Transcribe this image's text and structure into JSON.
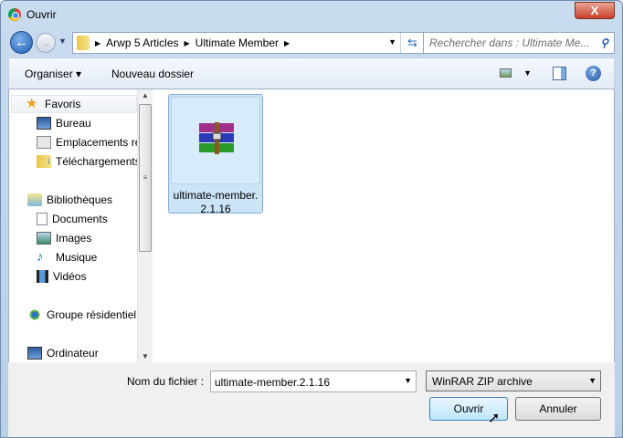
{
  "window": {
    "title": "Ouvrir",
    "close": "X"
  },
  "nav": {
    "breadcrumbs": [
      "Arwp 5 Articles",
      "Ultimate Member"
    ],
    "search_placeholder": "Rechercher dans : Ultimate Me..."
  },
  "toolbar": {
    "organize": "Organiser ▾",
    "new_folder": "Nouveau dossier",
    "help": "?"
  },
  "sidebar": {
    "items": [
      {
        "label": "Favoris",
        "icon": "star-icon"
      },
      {
        "label": "Bureau",
        "icon": "desktop-icon"
      },
      {
        "label": "Emplacements ré",
        "icon": "recent-places-icon"
      },
      {
        "label": "Téléchargements",
        "icon": "downloads-icon"
      },
      {
        "label": "Bibliothèques",
        "icon": "libraries-icon"
      },
      {
        "label": "Documents",
        "icon": "documents-icon"
      },
      {
        "label": "Images",
        "icon": "images-icon"
      },
      {
        "label": "Musique",
        "icon": "music-icon"
      },
      {
        "label": "Vidéos",
        "icon": "videos-icon"
      },
      {
        "label": "Groupe résidentiel",
        "icon": "homegroup-icon"
      },
      {
        "label": "Ordinateur",
        "icon": "computer-icon"
      }
    ]
  },
  "files": [
    {
      "name": "ultimate-member.2.1.16",
      "icon": "winrar-archive-icon"
    }
  ],
  "bottom": {
    "filename_label": "Nom du fichier :",
    "filename_value": "ultimate-member.2.1.16",
    "filetype": "WinRAR ZIP archive",
    "open": "Ouvrir",
    "cancel": "Annuler"
  }
}
